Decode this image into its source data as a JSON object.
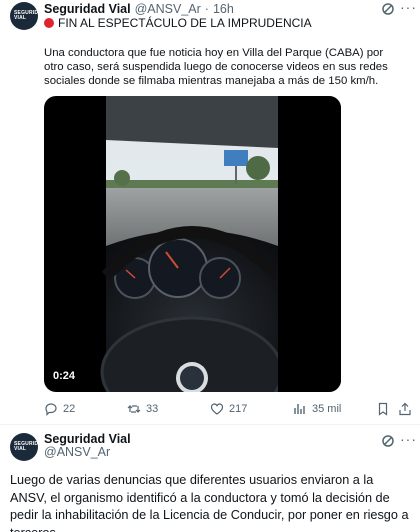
{
  "tweet1": {
    "author": {
      "name": "Seguridad Vial",
      "handle": "@ANSV_Ar",
      "separator": "·",
      "time": "16h"
    },
    "avatar": {
      "line1": "SEGURIDAD",
      "line2": "VIAL"
    },
    "headline": "FIN AL ESPECTÁCULO DE LA IMPRUDENCIA",
    "body": "Una conductora que fue noticia hoy en Villa del Parque (CABA) por otro caso, será suspendida luego de conocerse videos en sus redes sociales donde se filmaba mientras manejaba a más de 150 km/h.",
    "media": {
      "duration": "0:24"
    },
    "actions": {
      "replies": "22",
      "reposts": "33",
      "likes": "217",
      "views": "35 mil"
    }
  },
  "tweet2": {
    "author": {
      "name": "Seguridad Vial",
      "handle": "@ANSV_Ar"
    },
    "avatar": {
      "line1": "SEGURIDAD",
      "line2": "VIAL"
    },
    "body": "Luego de varias denuncias que diferentes usuarios enviaron a la ANSV, el organismo identificó a la conductora y tomó la decisión de pedir la inhabilitación de la Licencia de Conducir, por poner en riesgo a terceros."
  },
  "colors": {
    "text": "#0f1419",
    "secondary": "#536471",
    "accent_red": "#e0242e",
    "divider": "#eff3f4"
  },
  "icons": [
    "grok-icon",
    "more-icon",
    "red-circle-icon",
    "reply-icon",
    "repost-icon",
    "like-icon",
    "views-icon",
    "bookmark-icon",
    "share-icon"
  ]
}
